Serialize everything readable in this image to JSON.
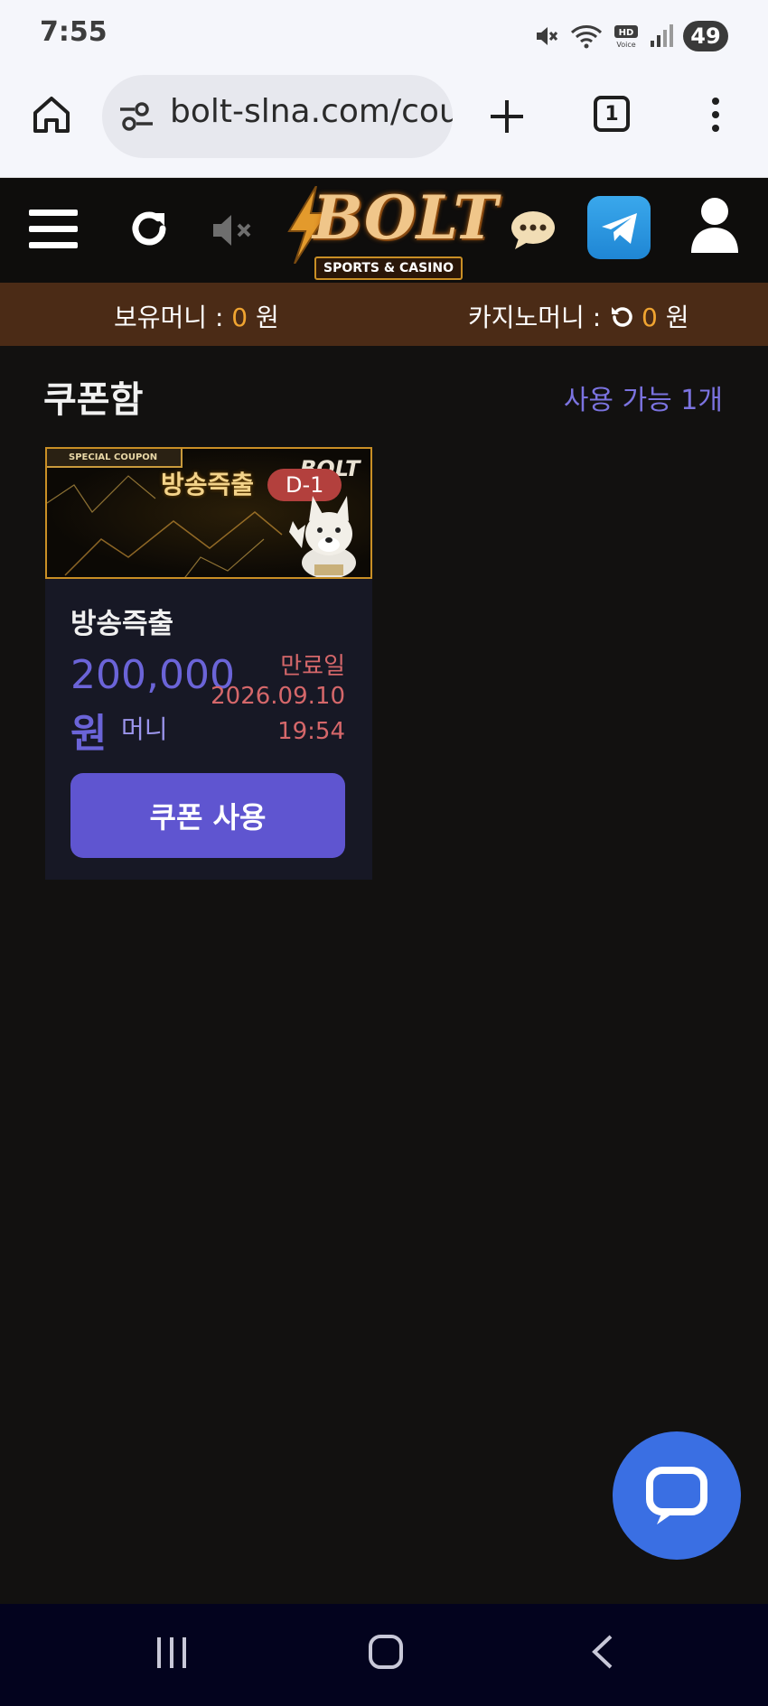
{
  "status_bar": {
    "time": "7:55",
    "battery": "49",
    "icons": [
      "mute-icon",
      "wifi-icon",
      "hd-voice-icon",
      "signal-icon"
    ]
  },
  "browser": {
    "url": "bolt-slna.com/cou",
    "tab_count": "1",
    "icons": [
      "home-icon",
      "site-settings-icon",
      "new-tab-icon",
      "tabs-icon",
      "more-menu-icon"
    ]
  },
  "header": {
    "logo_text": "BOLT",
    "logo_sub": "SPORTS & CASINO",
    "icons": [
      "hamburger-icon",
      "refresh-icon",
      "sound-mute-icon",
      "chat-icon",
      "telegram-icon",
      "user-icon"
    ]
  },
  "money_bar": {
    "holding_label": "보유머니 : ",
    "holding_value": "0",
    "holding_unit": " 원",
    "casino_label": "카지노머니 : ",
    "casino_value": "0",
    "casino_unit": " 원"
  },
  "coupon_box": {
    "title": "쿠폰함",
    "available": "사용 가능 1개",
    "coupons": [
      {
        "banner_tag": "SPECIAL COUPON",
        "banner_title": "방송즉출",
        "banner_brand": "BOLT",
        "dday": "D-1",
        "name": "방송즉출",
        "amount": "200,000",
        "amount_unit": "원",
        "money_type": "머니",
        "expiry_label": "만료일",
        "expiry_date": "2026.09.10",
        "expiry_time": "19:54",
        "use_button": "쿠폰 사용"
      }
    ]
  },
  "colors": {
    "accent": "#5f55d0",
    "money_bar": "#4b2b16",
    "expiry": "#d5676a",
    "highlight": "#f0a431",
    "chat_fab": "#3a6fe3"
  },
  "nav_bar": {
    "icons": [
      "recent-apps-icon",
      "home-nav-icon",
      "back-icon"
    ]
  }
}
